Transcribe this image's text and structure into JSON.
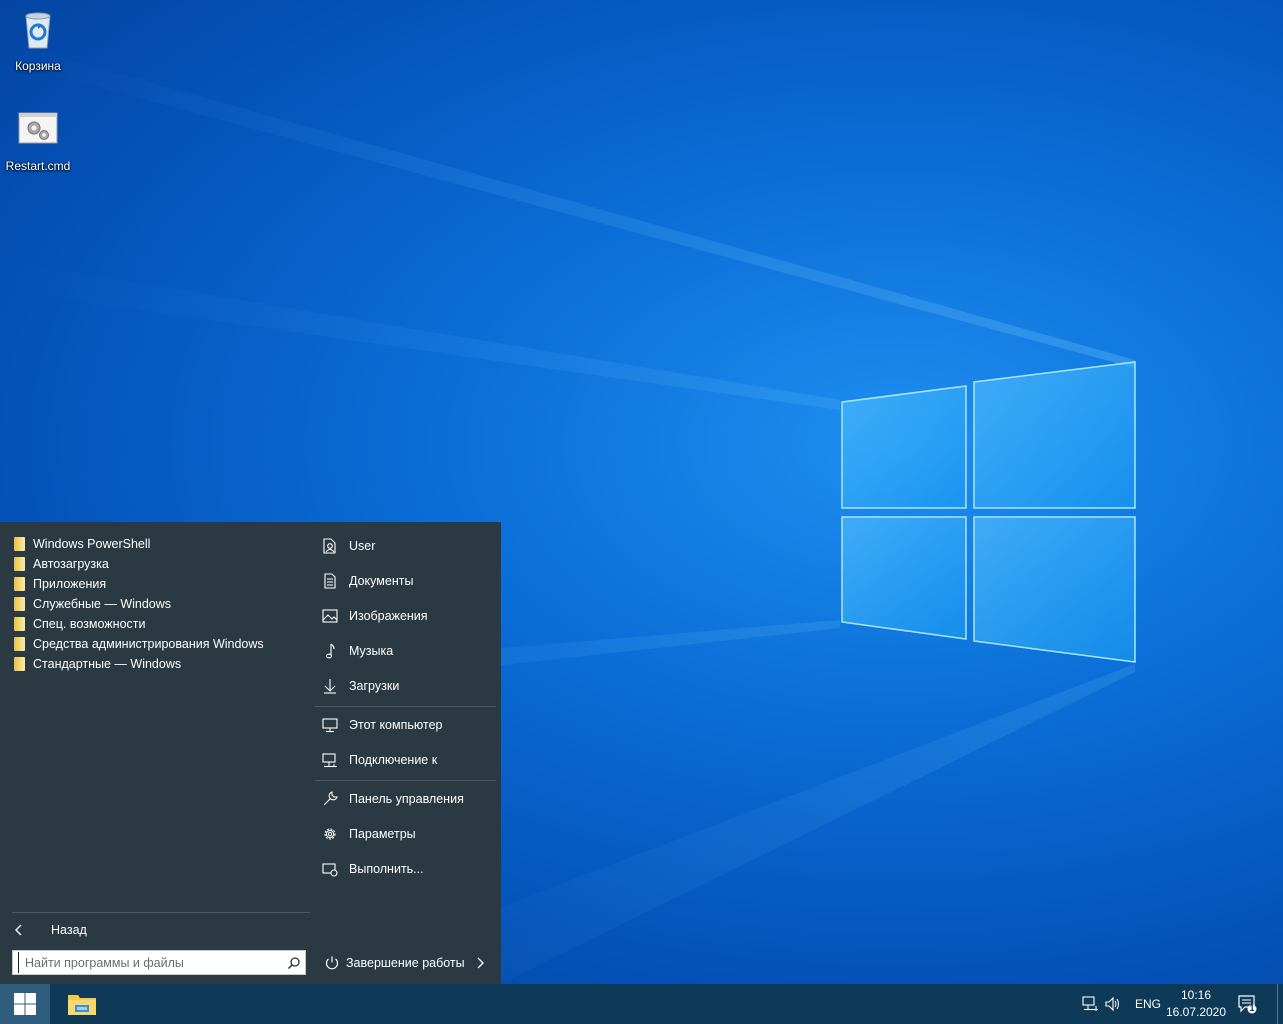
{
  "desktop": {
    "icons": [
      {
        "label": "Корзина",
        "icon": "recycle-bin-icon"
      },
      {
        "label": "Restart.cmd",
        "icon": "cmd-file-icon"
      }
    ]
  },
  "start_menu": {
    "folders": [
      {
        "label": "Windows PowerShell"
      },
      {
        "label": "Автозагрузка"
      },
      {
        "label": "Приложения"
      },
      {
        "label": "Служебные — Windows"
      },
      {
        "label": "Спец. возможности"
      },
      {
        "label": "Средства администрирования Windows"
      },
      {
        "label": "Стандартные — Windows"
      }
    ],
    "back_label": "Назад",
    "search_placeholder": "Найти программы и файлы",
    "places": [
      {
        "label": "User",
        "icon": "user-icon"
      },
      {
        "label": "Документы",
        "icon": "document-icon"
      },
      {
        "label": "Изображения",
        "icon": "picture-icon"
      },
      {
        "label": "Музыка",
        "icon": "music-note-icon"
      },
      {
        "label": "Загрузки",
        "icon": "download-arrow-icon"
      },
      {
        "label": "Этот компьютер",
        "icon": "monitor-icon"
      },
      {
        "label": "Подключение к",
        "icon": "network-connect-icon"
      },
      {
        "label": "Панель управления",
        "icon": "wrench-icon"
      },
      {
        "label": "Параметры",
        "icon": "gear-icon"
      },
      {
        "label": "Выполнить...",
        "icon": "run-icon"
      }
    ],
    "power_label": "Завершение работы"
  },
  "taskbar": {
    "language": "ENG",
    "time": "10:16",
    "date": "16.07.2020",
    "notification_count": "1"
  },
  "colors": {
    "start_menu_bg": "#2b3a42",
    "taskbar_bg": "#0e3a57",
    "accent": "#2e5d7d"
  }
}
